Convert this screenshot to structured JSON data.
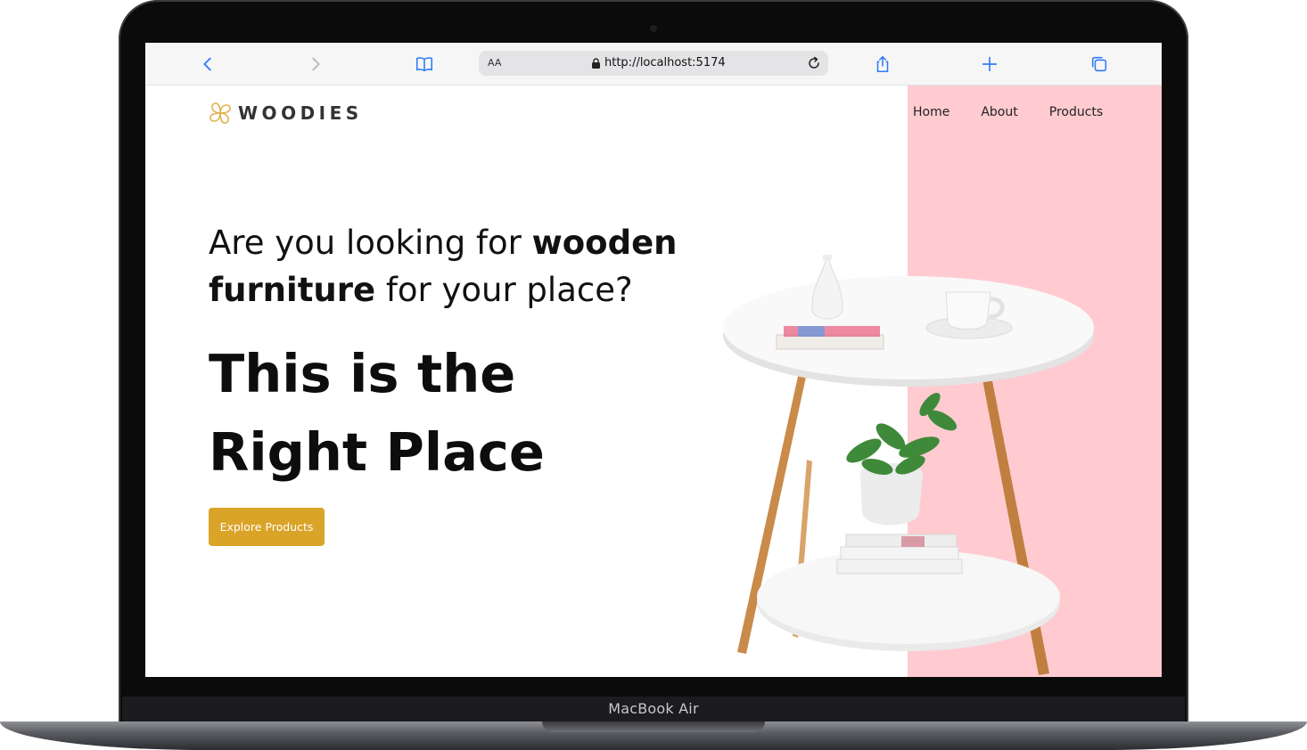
{
  "device": {
    "label": "MacBook Air"
  },
  "browser": {
    "address_bar": {
      "text_size_label": "AA",
      "url": "http://localhost:5174"
    }
  },
  "site": {
    "brand": "WOODIES",
    "nav": [
      "Home",
      "About",
      "Products"
    ],
    "hero": {
      "lead_plain_1": "Are you looking for ",
      "lead_bold_1": "wooden furniture",
      "lead_plain_2": " for your place?",
      "headline_line1": "This is the",
      "headline_line2": "Right Place",
      "cta_label": "Explore Products"
    }
  },
  "colors": {
    "accent": "#d9a428",
    "panel": "#ffcbd1",
    "browser_blue": "#2f7cf6"
  },
  "icons": [
    "back-icon",
    "forward-icon",
    "bookmarks-icon",
    "lock-icon",
    "reload-icon",
    "share-icon",
    "new-tab-icon",
    "tabs-icon",
    "logo-icon"
  ]
}
